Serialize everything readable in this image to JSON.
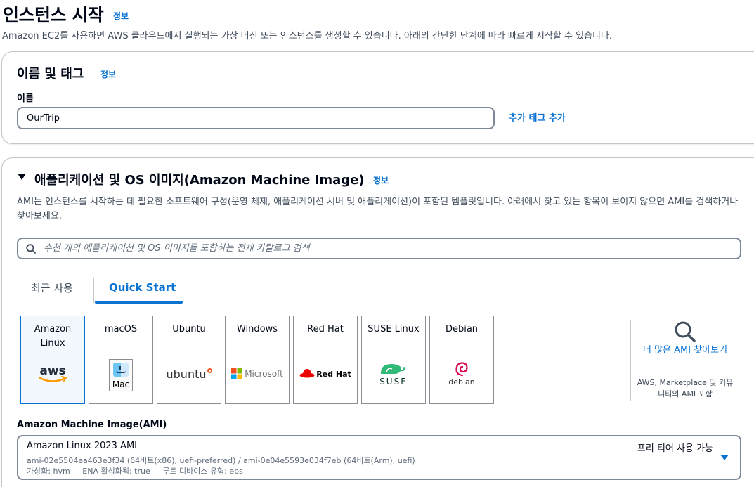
{
  "header": {
    "title": "인스턴스 시작",
    "info": "정보",
    "description": "Amazon EC2를 사용하면 AWS 클라우드에서 실행되는 가상 머신 또는 인스턴스를 생성할 수 있습니다. 아래의 간단한 단계에 따라 빠르게 시작할 수 있습니다."
  },
  "name_tags": {
    "heading": "이름 및 태그",
    "info": "정보",
    "name_label": "이름",
    "name_value": "OurTrip",
    "add_tags": "추가 태그 추가"
  },
  "ami": {
    "heading": "애플리케이션 및 OS 이미지(Amazon Machine Image)",
    "info": "정보",
    "description": "AMI는 인스턴스를 시작하는 데 필요한 소프트웨어 구성(운영 체제, 애플리케이션 서버 및 애플리케이션)이 포함된 템플릿입니다. 아래에서 찾고 있는 항목이 보이지 않으면 AMI를 검색하거나 찾아보세요.",
    "search_placeholder": "수천 개의 애플리케이션 및 OS 이미지를 포함하는 전체 카탈로그 검색",
    "tabs": [
      {
        "label": "최근 사용",
        "active": false
      },
      {
        "label": "Quick Start",
        "active": true
      }
    ],
    "os_options": [
      {
        "name": "Amazon Linux",
        "logo": "aws-logo",
        "selected": true
      },
      {
        "name": "macOS",
        "logo": "mac-finder-logo",
        "logo_text": "Mac",
        "selected": false
      },
      {
        "name": "Ubuntu",
        "logo": "ubuntu-logo",
        "logo_text": "ubuntu",
        "selected": false
      },
      {
        "name": "Windows",
        "logo": "microsoft-logo",
        "logo_text": "Microsoft",
        "selected": false
      },
      {
        "name": "Red Hat",
        "logo": "redhat-logo",
        "logo_text": "Red Hat",
        "selected": false
      },
      {
        "name": "SUSE Linux",
        "logo": "suse-logo",
        "logo_text": "SUSE",
        "selected": false
      },
      {
        "name": "Debian",
        "logo": "debian-logo",
        "logo_text": "debian",
        "selected": false
      }
    ],
    "browse_more": "더 많은 AMI 찾아보기",
    "browse_more_sub": "AWS, Marketplace 및 커뮤니티의 AMI 포함",
    "ami_label": "Amazon Machine Image(AMI)",
    "selected_ami": {
      "name": "Amazon Linux 2023 AMI",
      "badge": "프리 티어 사용 가능",
      "ids": "ami-02e5504ea463e3f34 (64비트(x86), uefi-preferred) / ami-0e04e5593e034f7eb (64비트(Arm), uefi)",
      "virtualization": "가상화: hvm",
      "ena": "ENA 활성화됨: true",
      "root_device": "루트 디바이스 유형: ebs"
    }
  },
  "colors": {
    "link": "#0972d3",
    "selected_card_bg": "#f2f8fd",
    "text": "#000716",
    "muted": "#414d5c",
    "aws_orange": "#ff9900",
    "ubuntu_orange": "#e95420",
    "redhat_red": "#ee0000",
    "suse_green": "#30ba78",
    "debian_red": "#d70a53"
  }
}
